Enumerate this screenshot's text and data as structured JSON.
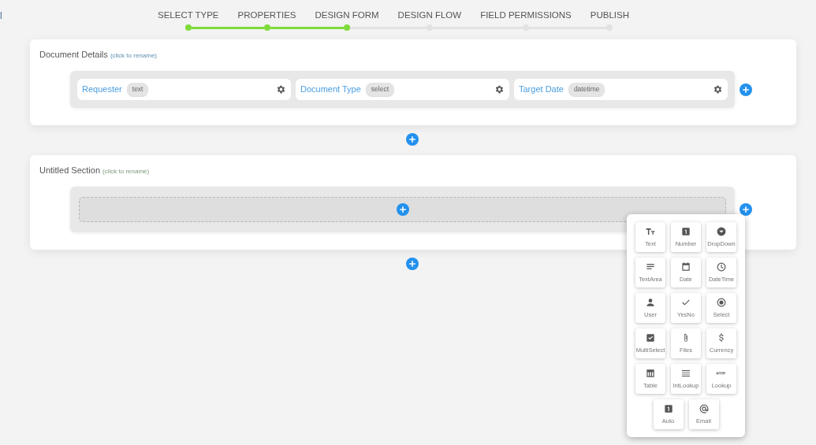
{
  "edge_text": "l",
  "steps": [
    {
      "label": "SELECT TYPE",
      "done": true
    },
    {
      "label": "PROPERTIES",
      "done": true
    },
    {
      "label": "DESIGN FORM",
      "done": true
    },
    {
      "label": "DESIGN FLOW",
      "done": false
    },
    {
      "label": "FIELD PERMISSIONS",
      "done": false
    },
    {
      "label": "PUBLISH",
      "done": false
    }
  ],
  "sections": [
    {
      "title": "Document Details",
      "hint": "(click to rename)",
      "fields": [
        {
          "label": "Requester",
          "type": "text"
        },
        {
          "label": "Document Type",
          "type": "select"
        },
        {
          "label": "Target Date",
          "type": "datetime"
        }
      ]
    },
    {
      "title": "Untitled Section",
      "hint": "(click to rename)"
    }
  ],
  "palette": [
    {
      "label": "Text",
      "kind": "text"
    },
    {
      "label": "Number",
      "kind": "number"
    },
    {
      "label": "DropDown",
      "kind": "dropdown"
    },
    {
      "label": "TextArea",
      "kind": "textarea"
    },
    {
      "label": "Date",
      "kind": "date"
    },
    {
      "label": "DateTime",
      "kind": "datetime"
    },
    {
      "label": "User",
      "kind": "user"
    },
    {
      "label": "YesNo",
      "kind": "yesno"
    },
    {
      "label": "Select",
      "kind": "select"
    },
    {
      "label": "MultiSelect",
      "kind": "multiselect"
    },
    {
      "label": "Files",
      "kind": "files"
    },
    {
      "label": "Currency",
      "kind": "currency"
    },
    {
      "label": "Table",
      "kind": "table"
    },
    {
      "label": "IntLookup",
      "kind": "intlookup"
    },
    {
      "label": "Lookup",
      "kind": "lookup"
    },
    {
      "label": "Auto",
      "kind": "auto"
    },
    {
      "label": "Email",
      "kind": "email"
    }
  ]
}
